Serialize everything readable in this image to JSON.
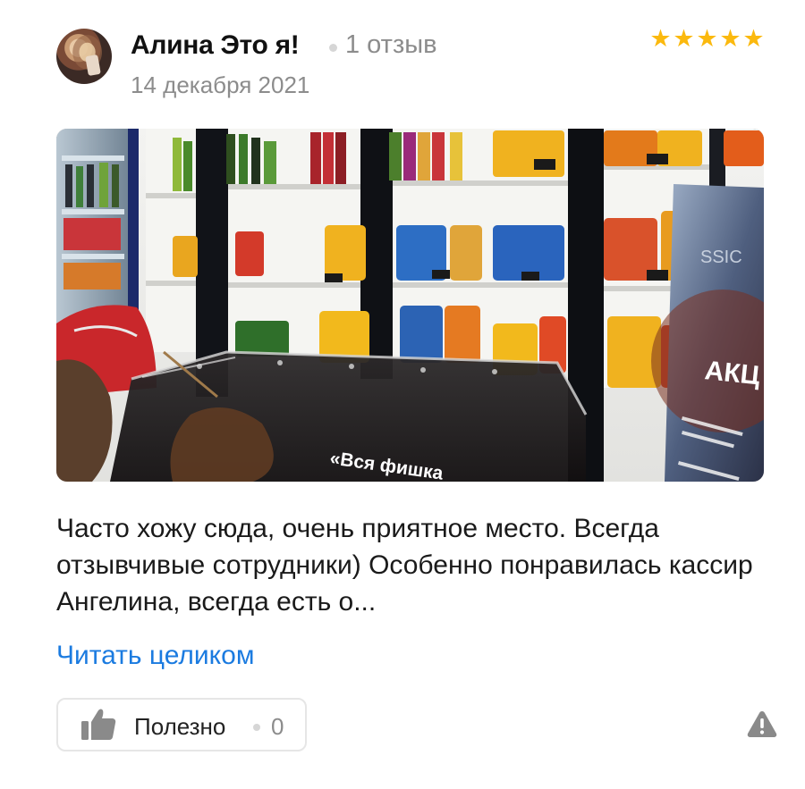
{
  "review": {
    "author_name": "Алина Это я!",
    "review_count": "1 отзыв",
    "date": "14 декабря 2021",
    "rating": 5,
    "text": "Часто хожу сюда, очень приятное место. Всегда отзывчивые сотрудники) Особенно понравилась кассир Ангелина, всегда есть о...",
    "read_more_label": "Читать целиком",
    "useful_label": "Полезно",
    "useful_count": "0",
    "photo_text": {
      "banner_quote": "«Вся фишка",
      "sign_text": "АКЦ",
      "classic_text": "SSIC"
    }
  },
  "icons": {
    "star": "star-icon",
    "thumb": "thumb-up-icon",
    "complain": "warning-triangle-icon"
  },
  "colors": {
    "star": "#fbb90e",
    "link": "#1b7be0",
    "muted": "#8c8c8c"
  }
}
